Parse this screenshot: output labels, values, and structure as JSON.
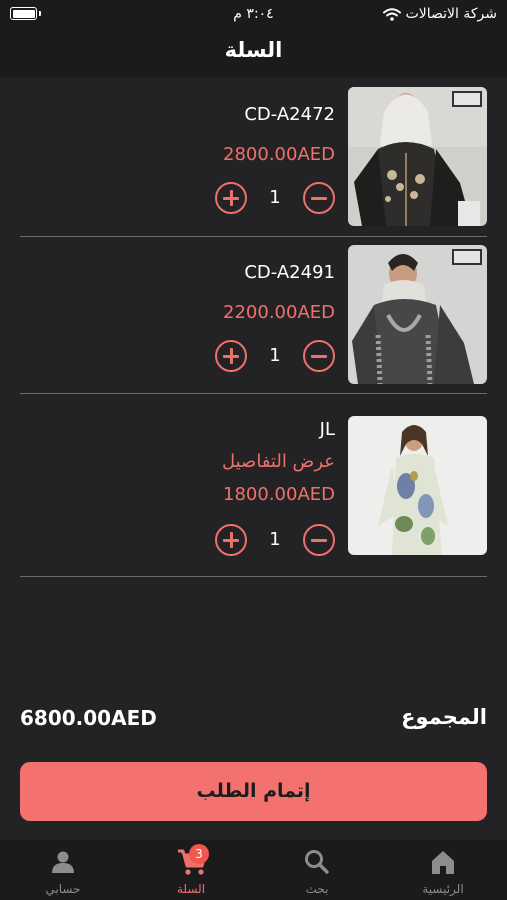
{
  "status_bar": {
    "carrier": "شركة الاتصالات",
    "time": "٣:٠٤ م"
  },
  "header": {
    "title": "السلة"
  },
  "cart": {
    "items": [
      {
        "name": "CD-A2472",
        "price": "2800.00AED",
        "quantity": "1"
      },
      {
        "name": "CD-A2491",
        "price": "2200.00AED",
        "quantity": "1"
      },
      {
        "name": "JL",
        "details_link": "عرض التفاصيل",
        "price": "1800.00AED",
        "quantity": "1"
      }
    ]
  },
  "summary": {
    "total_label": "المجموع",
    "total_value": "6800.00AED"
  },
  "checkout": {
    "label": "إتمام الطلب"
  },
  "tabbar": {
    "home": "الرئيسية",
    "search": "بحث",
    "cart": "السلة",
    "cart_badge": "3",
    "account": "حسابي"
  },
  "colors": {
    "accent": "#f0706a",
    "background": "#232325",
    "bar": "#1b1b1c"
  }
}
